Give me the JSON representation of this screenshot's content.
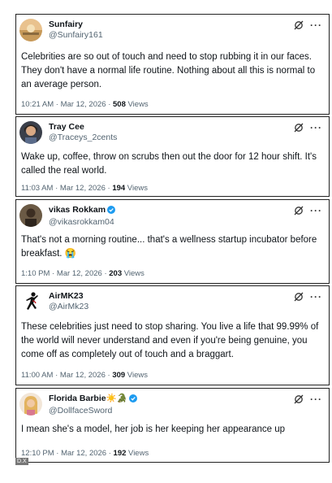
{
  "tweets": [
    {
      "display_name": "Sunfairy",
      "handle": "@Sunfairy161",
      "verified": false,
      "text": "Celebrities are so out of touch and need to stop rubbing it in our faces. They don't have a normal life routine.  Nothing about all this is normal to an average person.",
      "time": "10:21 AM · Mar 12, 2026 · ",
      "views": "508",
      "views_label": " Views"
    },
    {
      "display_name": "Tray Cee",
      "handle": "@Traceys_2cents",
      "verified": false,
      "text": "Wake up, coffee, throw on scrubs then out the door for 12 hour shift.  It's called the real world.",
      "time": "11:03 AM · Mar 12, 2026 · ",
      "views": "194",
      "views_label": " Views"
    },
    {
      "display_name": "vikas Rokkam",
      "handle": "@vikasrokkam04",
      "verified": true,
      "text": "That's not a morning routine... that's a wellness startup incubator before breakfast. 😭",
      "time": "1:10 PM · Mar 12, 2026 · ",
      "views": "203",
      "views_label": " Views"
    },
    {
      "display_name": "AirMK23",
      "handle": "@AirMk23",
      "verified": false,
      "text": "These celebrities just need to stop sharing. You live a life that 99.99% of the world will never understand and even if you're being genuine, you come off as completely out of touch and a braggart.",
      "time": "11:00 AM · Mar 12, 2026 · ",
      "views": "309",
      "views_label": " Views"
    },
    {
      "display_name": "Florida Barbie☀️🐊",
      "handle": "@DollfaceSword",
      "verified": true,
      "text": "I mean she's a model, her job is her keeping her appearance up",
      "time": "12:10 PM · Mar 12, 2026 · ",
      "views": "192",
      "views_label": " Views"
    }
  ],
  "more_glyph": "···",
  "watermark": "D.X",
  "colors": {
    "text": "#0f1419",
    "secondary": "#536471",
    "verified": "#1d9bf0",
    "border": "#222222"
  }
}
